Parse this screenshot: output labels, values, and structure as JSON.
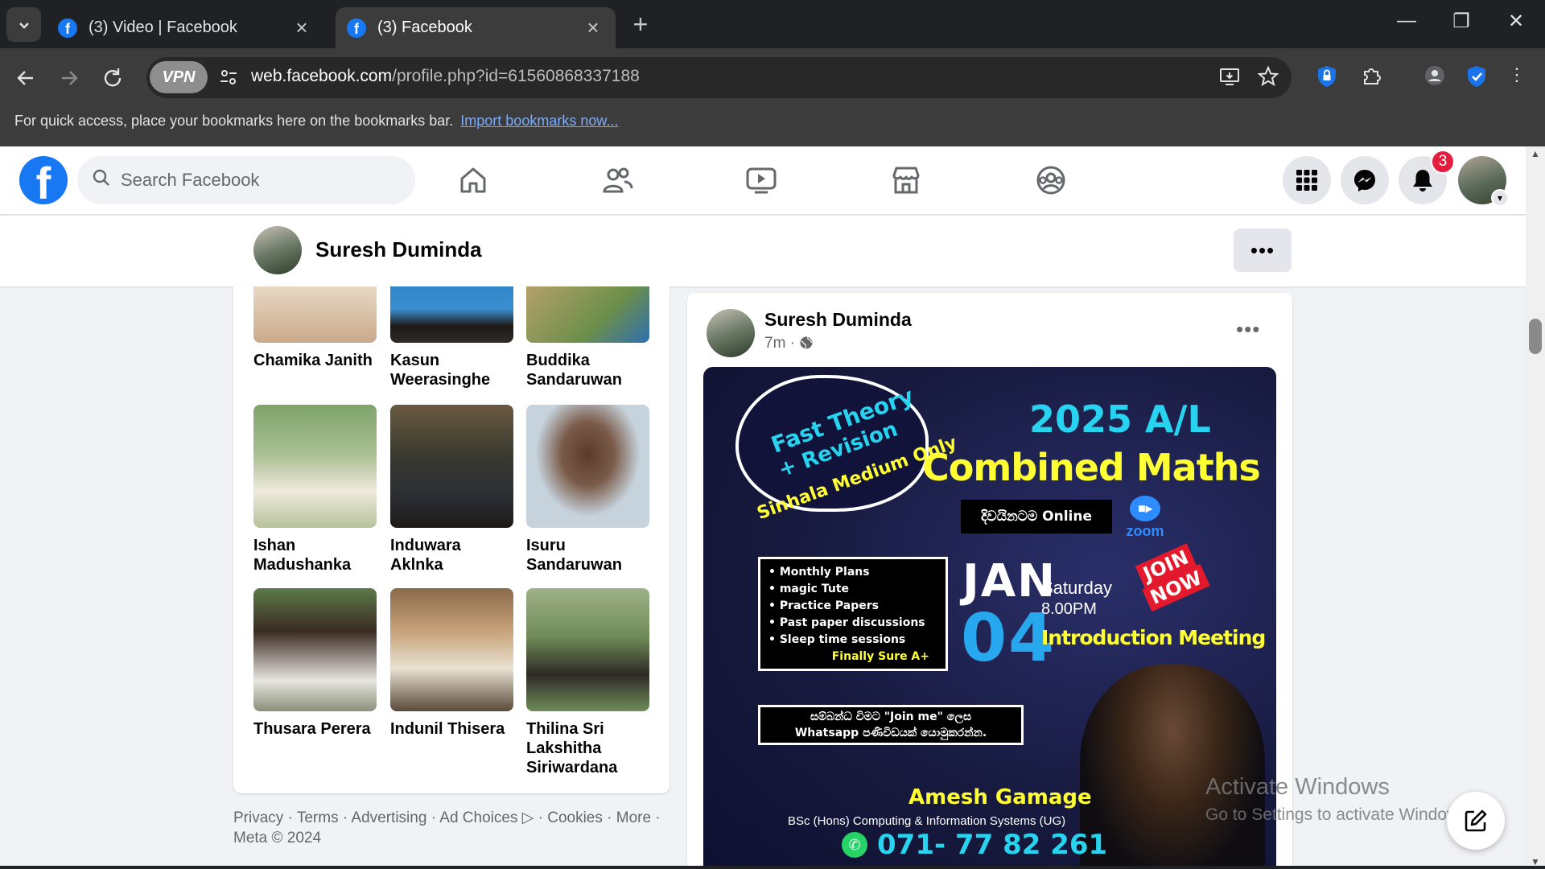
{
  "browser": {
    "tabs": [
      {
        "title": "(3) Video | Facebook",
        "active": false
      },
      {
        "title": "(3) Facebook",
        "active": true
      }
    ],
    "url_host": "web.facebook.com",
    "url_path": "/profile.php?id=61560868337188",
    "vpn_label": "VPN",
    "bookmarks_message": "For quick access, place your bookmarks here on the bookmarks bar.",
    "bookmarks_link": "Import bookmarks now..."
  },
  "facebook": {
    "search_placeholder": "Search Facebook",
    "notification_count": "3",
    "brand_color": "#1877f2"
  },
  "profile_bar": {
    "name": "Suresh Duminda",
    "more_label": "•••"
  },
  "friends": [
    {
      "name": "Chamika Janith",
      "photo": "#d9c9b2"
    },
    {
      "name": "Kasun Weerasinghe",
      "photo": "#4a90c2"
    },
    {
      "name": "Buddika Sandaruwan",
      "photo": "#8fa56a"
    },
    {
      "name": "Ishan Madushanka",
      "photo": "#a7b58c"
    },
    {
      "name": "Induwara Aklnka",
      "photo": "#5d5547"
    },
    {
      "name": "Isuru Sandaruwan",
      "photo": "#b8c2c9"
    },
    {
      "name": "Thusara Perera",
      "photo": "#7f8a6a"
    },
    {
      "name": "Indunil Thisera",
      "photo": "#9a6f4f"
    },
    {
      "name": "Thilina Sri Lakshitha Siriwardana",
      "photo": "#6f8c5a"
    }
  ],
  "footer": {
    "links": [
      "Privacy",
      "Terms",
      "Advertising",
      "Ad Choices",
      "Cookies",
      "More"
    ],
    "copyright": "Meta © 2024"
  },
  "post": {
    "author": "Suresh Duminda",
    "time": "7m ·",
    "flyer": {
      "cloud_line1": "Fast Theory",
      "cloud_line2": "+ Revision",
      "cloud_line3": "Sinhala Medium Only",
      "year_title": "2025 A/L",
      "subject": "Combined Maths",
      "online_text": "දිවයිනටම Online",
      "zoom_label": "zoom",
      "features": [
        "• Monthly Plans",
        "• magic Tute",
        "• Practice Papers",
        "• Past paper discussions",
        "• Sleep time sessions"
      ],
      "features_footer": "Finally Sure A+",
      "month": "JAN",
      "day": "04",
      "weekday": "Saturday",
      "time": "8.00PM",
      "intro": "Introduction Meeting",
      "join_line1": "JOIN",
      "join_line2": "NOW",
      "whatsapp_line1": "සම්බන්ධ විමට \"Join me\" ලෙස",
      "whatsapp_line2": "Whatsapp පණිවිඩයක් යොමුකරන්න.",
      "tutor_name": "Amesh Gamage",
      "tutor_qualification": "BSc (Hons) Computing & Information Systems (UG)",
      "phone": "071- 77 82 261"
    }
  },
  "windows_watermark": {
    "line1": "Activate Windows",
    "line2": "Go to Settings to activate Windows."
  }
}
